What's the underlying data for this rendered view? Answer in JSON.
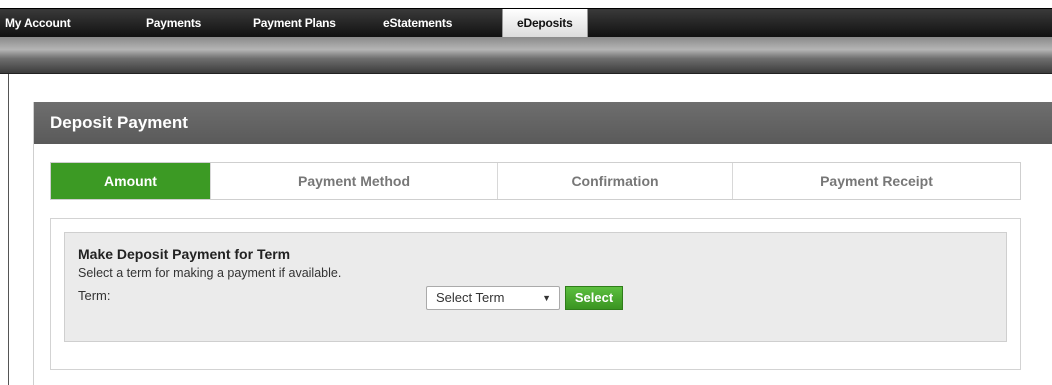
{
  "nav": {
    "items": [
      {
        "label": "My Account"
      },
      {
        "label": "Payments"
      },
      {
        "label": "Payment Plans"
      },
      {
        "label": "eStatements"
      },
      {
        "label": "eDeposits"
      }
    ],
    "active": "eDeposits"
  },
  "panel": {
    "title": "Deposit Payment"
  },
  "steps": {
    "items": [
      {
        "label": "Amount"
      },
      {
        "label": "Payment Method"
      },
      {
        "label": "Confirmation"
      },
      {
        "label": "Payment Receipt"
      }
    ],
    "active": "Amount"
  },
  "form": {
    "title": "Make Deposit Payment for Term",
    "description": "Select a term  for making a payment if available.",
    "term_label": "Term:",
    "term_select_value": "Select Term",
    "select_button": "Select"
  },
  "colors": {
    "accent_green": "#3c9a24",
    "header_gray": "#666666",
    "nav_dark": "#1a1a1a"
  },
  "icons": {
    "dropdown": "chevron-down-icon"
  }
}
